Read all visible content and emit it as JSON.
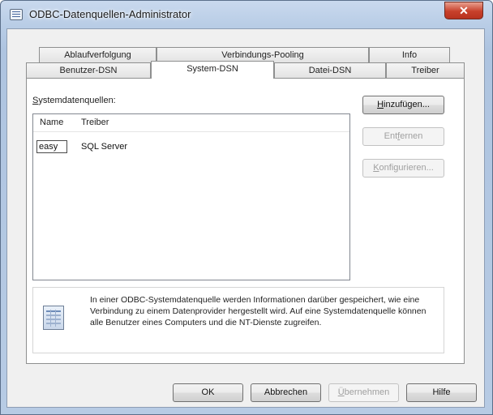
{
  "window": {
    "title": "ODBC-Datenquellen-Administrator",
    "close_glyph": "✕"
  },
  "tabs": {
    "row1": [
      "Ablaufverfolgung",
      "Verbindungs-Pooling",
      "Info"
    ],
    "row2": [
      "Benutzer-DSN",
      "System-DSN",
      "Datei-DSN",
      "Treiber"
    ],
    "active": "System-DSN"
  },
  "panel": {
    "label_first": "S",
    "label_rest": "ystemdatenquellen:",
    "columns": [
      "Name",
      "Treiber"
    ],
    "rows": [
      {
        "name": "easy",
        "driver": "SQL Server"
      }
    ]
  },
  "side_buttons": {
    "add_first": "H",
    "add_rest": "inzufügen...",
    "remove_first": "Ent",
    "remove_mid": "f",
    "remove_rest": "ernen",
    "configure_first": "K",
    "configure_rest": "onfigurieren..."
  },
  "info": {
    "icon": "datasource-table-icon",
    "text": "In einer ODBC-Systemdatenquelle werden Informationen darüber gespeichert, wie eine Verbindung zu einem Datenprovider hergestellt wird. Auf eine Systemdatenquelle können alle Benutzer eines Computers und die NT-Dienste zugreifen."
  },
  "footer_buttons": {
    "ok": "OK",
    "cancel": "Abbrechen",
    "apply_first": "Ü",
    "apply_rest": "bernehmen",
    "help": "Hilfe"
  }
}
